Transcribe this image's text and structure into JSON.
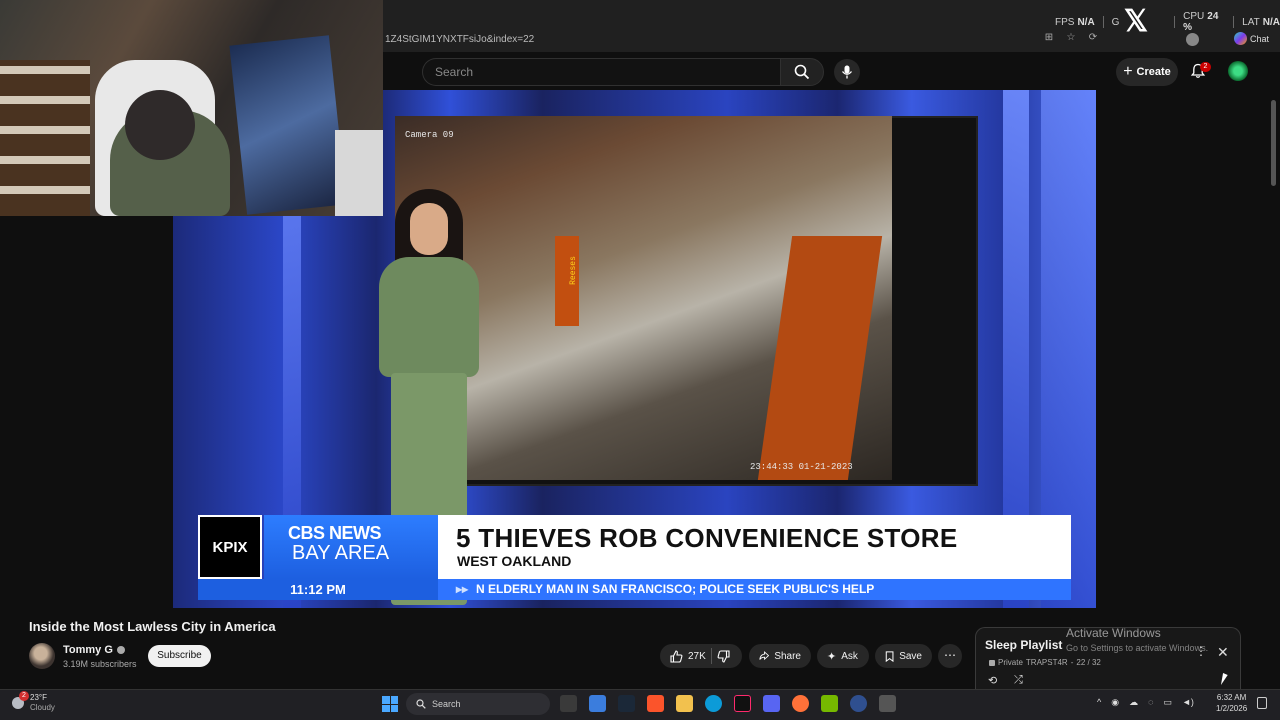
{
  "browser": {
    "url": "1Z4StGIM1YNXTFsiJo&index=22",
    "chat_label": "Chat"
  },
  "perf_overlay": {
    "fps_label": "FPS",
    "fps_value": "N/A",
    "gpu_label": "G",
    "cpu_label": "CPU",
    "cpu_value": "24 %",
    "lat_label": "LAT",
    "lat_value": "N/A"
  },
  "header": {
    "search_placeholder": "Search",
    "create_label": "Create",
    "notification_count": "2"
  },
  "video_overlay": {
    "station": "KPIX",
    "network_line1": "CBS NEWS",
    "network_line2": "BAY AREA",
    "headline": "5 THIEVES ROB CONVENIENCE STORE",
    "subhead": "WEST OAKLAND",
    "time": "11:12 PM",
    "ticker": "N ELDERLY MAN IN SAN FRANCISCO; POLICE SEEK PUBLIC'S HELP",
    "camera_label": "Camera 09",
    "cctv_timestamp": "23:44:33 01-21-2023",
    "store_sign": "Reeses"
  },
  "video_info": {
    "title": "Inside the Most Lawless City in America",
    "channel": "Tommy G",
    "subscribers": "3.19M subscribers",
    "subscribe_label": "Subscribe",
    "likes": "27K",
    "share_label": "Share",
    "ask_label": "Ask",
    "save_label": "Save"
  },
  "playlist": {
    "title": "Sleep Playlist",
    "privacy": "Private",
    "owner": "TRAPST4R",
    "position": "22 / 32"
  },
  "watermark": {
    "title": "Activate Windows",
    "subtitle": "Go to Settings to activate Windows."
  },
  "taskbar": {
    "temperature": "23°F",
    "condition": "Cloudy",
    "weather_badge": "2",
    "search_label": "Search",
    "time": "6:32 AM",
    "date": "1/2/2026"
  }
}
